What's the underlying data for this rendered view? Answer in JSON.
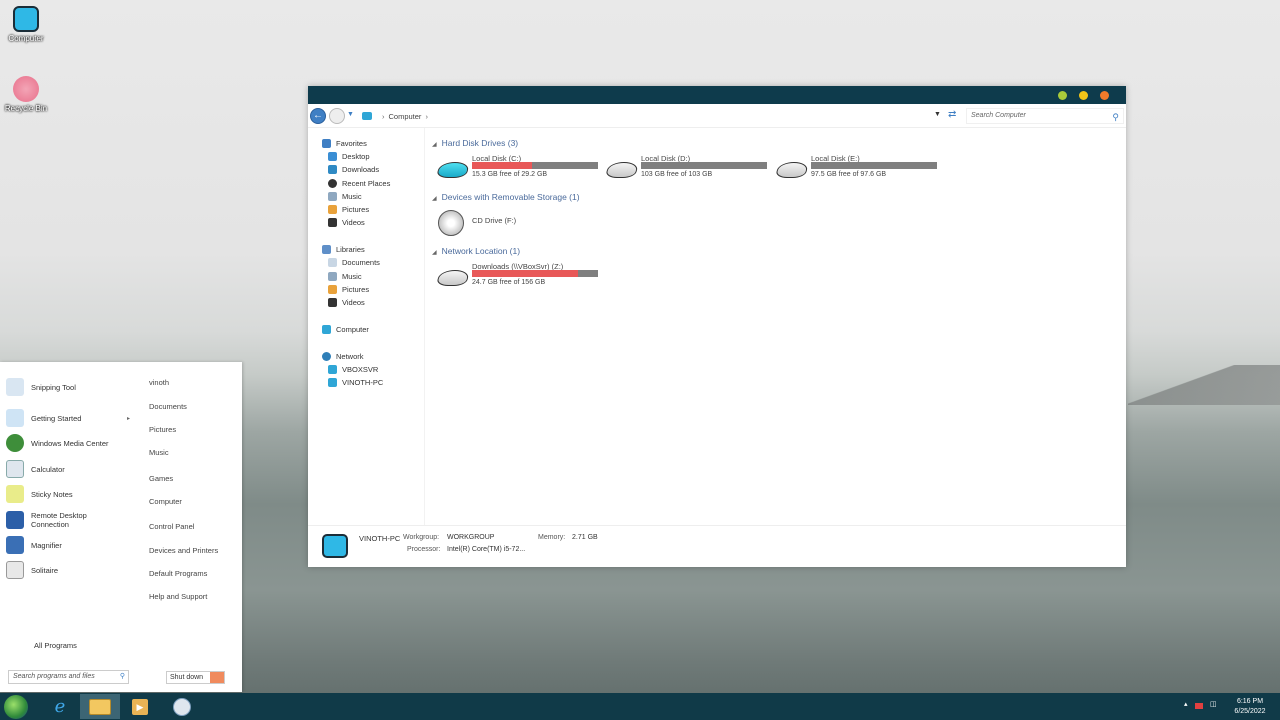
{
  "desktop": {
    "icons": [
      {
        "label": "Computer",
        "icon": "computer-icon"
      },
      {
        "label": "Recycle Bin",
        "icon": "recycle-bin-icon"
      }
    ]
  },
  "explorer": {
    "titlebar_buttons": [
      "#a8c93a",
      "#f2c418",
      "#f07a2a"
    ],
    "address": {
      "root": "Computer"
    },
    "search": {
      "placeholder": "Search Computer"
    },
    "sidebar": {
      "favorites_header": "Favorites",
      "favorites": [
        "Desktop",
        "Downloads",
        "Recent Places",
        "Music",
        "Pictures",
        "Videos"
      ],
      "libraries_header": "Libraries",
      "libraries": [
        "Documents",
        "Music",
        "Pictures",
        "Videos"
      ],
      "computer": "Computer",
      "network_header": "Network",
      "network": [
        "VBOXSVR",
        "VINOTH-PC"
      ]
    },
    "groups": {
      "hard_disks": "Hard Disk Drives (3)",
      "removable": "Devices with Removable Storage (1)",
      "network": "Network Location (1)"
    },
    "drives": [
      {
        "name": "Local Disk (C:)",
        "free": "15.3 GB free of 29.2 GB",
        "used_fraction": 0.48
      },
      {
        "name": "Local Disk (D:)",
        "free": "103 GB free of 103 GB",
        "used_fraction": 0.0
      },
      {
        "name": "Local Disk (E:)",
        "free": "97.5 GB free of 97.6 GB",
        "used_fraction": 0.0
      }
    ],
    "removable": [
      {
        "name": "CD Drive (F:)"
      }
    ],
    "network_locations": [
      {
        "name": "Downloads (\\\\VBoxSvr) (Z:)",
        "free": "24.7 GB free of 156 GB",
        "used_fraction": 0.84
      }
    ],
    "details": {
      "pc_name": "VINOTH-PC",
      "workgroup_label": "Workgroup:",
      "workgroup": "WORKGROUP",
      "memory_label": "Memory:",
      "memory": "2.71 GB",
      "processor_label": "Processor:",
      "processor": "Intel(R) Core(TM) i5-72..."
    }
  },
  "start_menu": {
    "programs": [
      {
        "label": "Snipping Tool",
        "icon": "scissors-icon",
        "color": "#d9e6f2"
      },
      {
        "label": "Getting Started",
        "icon": "getting-started-icon",
        "color": "#cfe4f5"
      },
      {
        "label": "Windows Media Center",
        "icon": "media-center-icon",
        "color": "#3e8e3a"
      },
      {
        "label": "Calculator",
        "icon": "calculator-icon",
        "color": "#dfe6ee"
      },
      {
        "label": "Sticky Notes",
        "icon": "sticky-notes-icon",
        "color": "#e9ec8a"
      },
      {
        "label": "Remote Desktop Connection",
        "icon": "remote-desktop-icon",
        "color": "#2c5fa8"
      },
      {
        "label": "Magnifier",
        "icon": "magnifier-icon",
        "color": "#3a6fb5"
      },
      {
        "label": "Solitaire",
        "icon": "solitaire-icon",
        "color": "#e8e8e8"
      }
    ],
    "right_links": [
      "vinoth",
      "Documents",
      "Pictures",
      "Music",
      "Games",
      "Computer",
      "Control Panel",
      "Devices and Printers",
      "Default Programs",
      "Help and Support"
    ],
    "all_programs": "All Programs",
    "search_placeholder": "Search programs and files",
    "shutdown": "Shut down"
  },
  "taskbar": {
    "time": "6:16 PM",
    "date": "6/25/2022",
    "pinned": [
      "internet-explorer-icon",
      "explorer-folder-icon",
      "media-player-icon",
      "paint-icon"
    ]
  }
}
